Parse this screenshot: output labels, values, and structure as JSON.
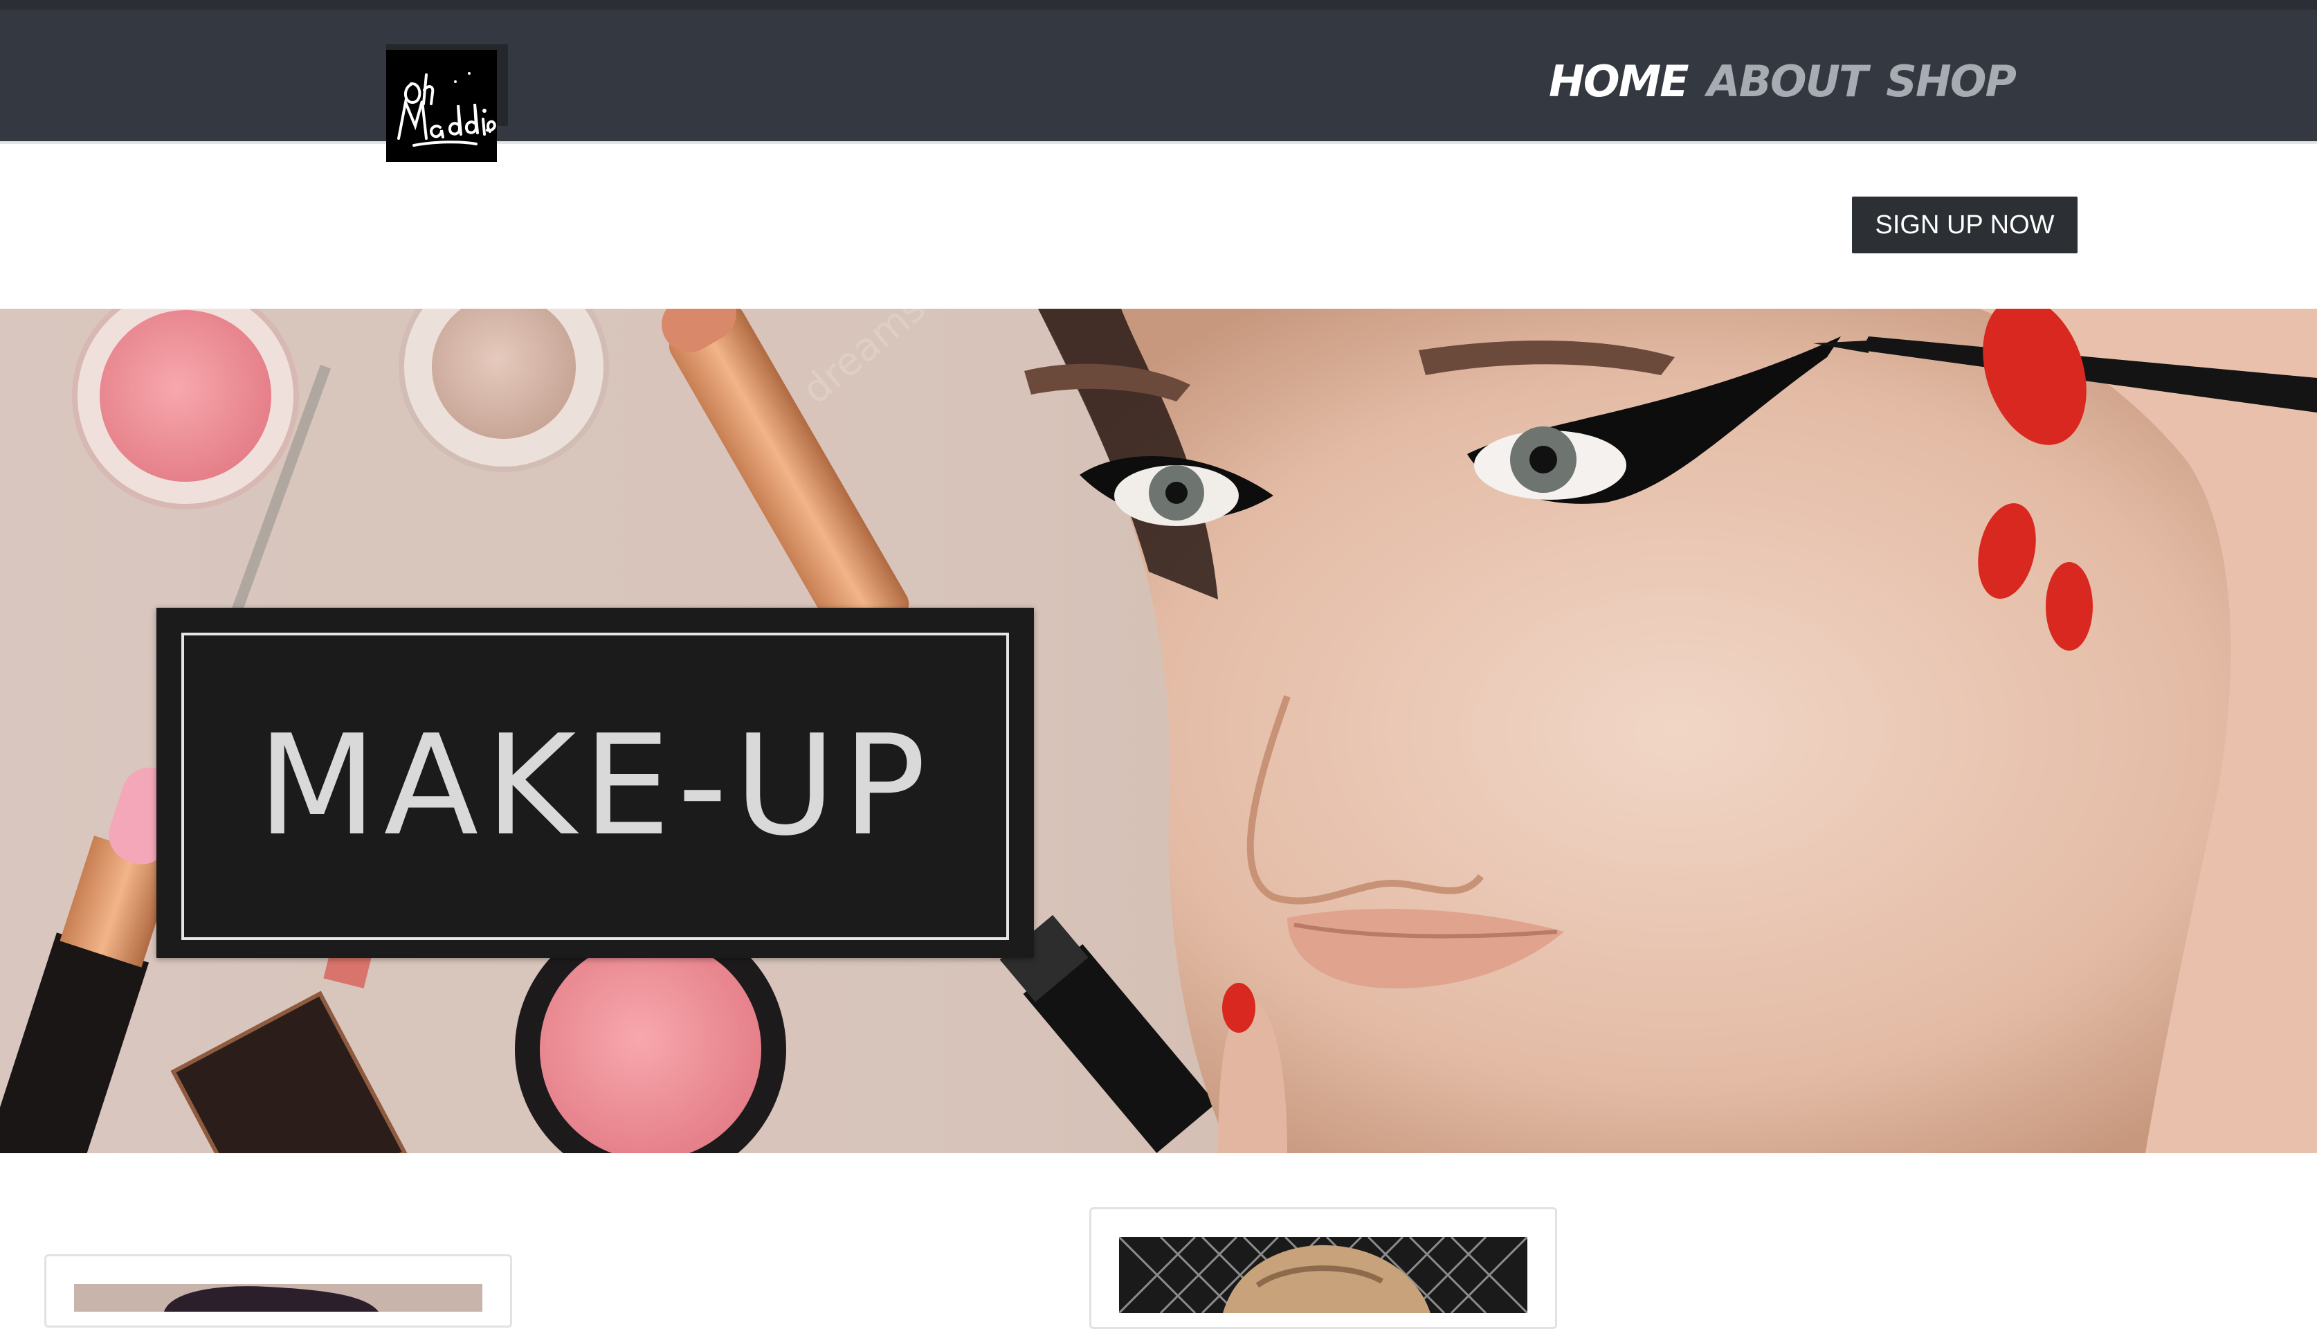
{
  "brand": {
    "logo_text": "Oh Maddie"
  },
  "nav": {
    "items": [
      {
        "label": "HOME",
        "active": true
      },
      {
        "label": "ABOUT",
        "active": false
      },
      {
        "label": "SHOP",
        "active": false
      }
    ]
  },
  "cta": {
    "signup_label": "SIGN UP NOW"
  },
  "hero": {
    "title": "MAKE-UP"
  },
  "colors": {
    "navbar": "#343941",
    "nav_active": "#ffffff",
    "nav_inactive": "#a7abb2",
    "button_bg": "#2c2f33",
    "nail_red": "#d8281f"
  }
}
